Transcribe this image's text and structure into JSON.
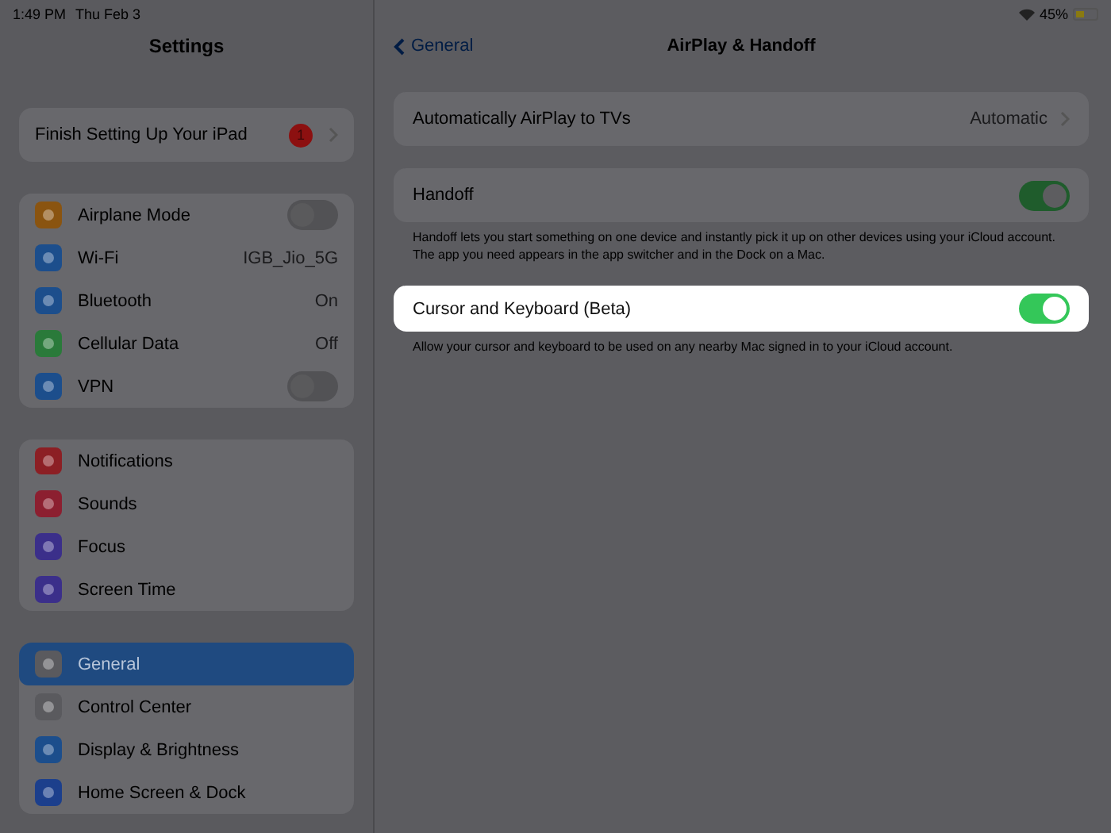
{
  "status_bar": {
    "time": "1:49 PM",
    "date": "Thu Feb 3",
    "battery": "45%"
  },
  "sidebar": {
    "title": "Settings",
    "groups": [
      [
        {
          "label": "Finish Setting Up Your iPad",
          "kind": "badge",
          "badge": "1",
          "selected": false
        }
      ],
      [
        {
          "label": "Airplane Mode",
          "kind": "toggle",
          "on": false,
          "color": "#8a5410",
          "selected": false
        },
        {
          "label": "Wi-Fi",
          "kind": "value",
          "value": "IGB_Jio_5G",
          "color": "#1c4e8c",
          "selected": false
        },
        {
          "label": "Bluetooth",
          "kind": "value",
          "value": "On",
          "color": "#1c4e8c",
          "selected": false
        },
        {
          "label": "Cellular Data",
          "kind": "value",
          "value": "Off",
          "color": "#2a7a3a",
          "selected": false
        },
        {
          "label": "VPN",
          "kind": "toggle",
          "on": false,
          "color": "#1c4e8c",
          "selected": false
        }
      ],
      [
        {
          "label": "Notifications",
          "kind": "link",
          "color": "#8c1f24",
          "selected": false
        },
        {
          "label": "Sounds",
          "kind": "link",
          "color": "#8c1f30",
          "selected": false
        },
        {
          "label": "Focus",
          "kind": "link",
          "color": "#3b2f8a",
          "selected": false
        },
        {
          "label": "Screen Time",
          "kind": "link",
          "color": "#3b2f8a",
          "selected": false
        }
      ],
      [
        {
          "label": "General",
          "kind": "link",
          "color": "#5a5a5e",
          "selected": true
        },
        {
          "label": "Control Center",
          "kind": "link",
          "color": "#5a5a5e",
          "selected": false
        },
        {
          "label": "Display & Brightness",
          "kind": "link",
          "color": "#1c4e8c",
          "selected": false
        },
        {
          "label": "Home Screen & Dock",
          "kind": "link",
          "color": "#1c3f8c",
          "selected": false
        }
      ]
    ]
  },
  "detail": {
    "back": "General",
    "title": "AirPlay & Handoff",
    "sections": [
      {
        "rows": [
          {
            "label": "Automatically AirPlay to TVs",
            "kind": "value",
            "value": "Automatic",
            "highlighted": false
          }
        ]
      },
      {
        "rows": [
          {
            "label": "Handoff",
            "kind": "toggle",
            "on": true,
            "highlighted": false
          }
        ],
        "footer": "Handoff lets you start something on one device and instantly pick it up on other devices using your iCloud account. The app you need appears in the app switcher and in the Dock on a Mac."
      },
      {
        "rows": [
          {
            "label": "Cursor and Keyboard (Beta)",
            "kind": "toggle",
            "on": true,
            "highlighted": true
          }
        ],
        "footer": "Allow your cursor and keyboard to be used on any nearby Mac signed in to your iCloud account."
      }
    ]
  }
}
